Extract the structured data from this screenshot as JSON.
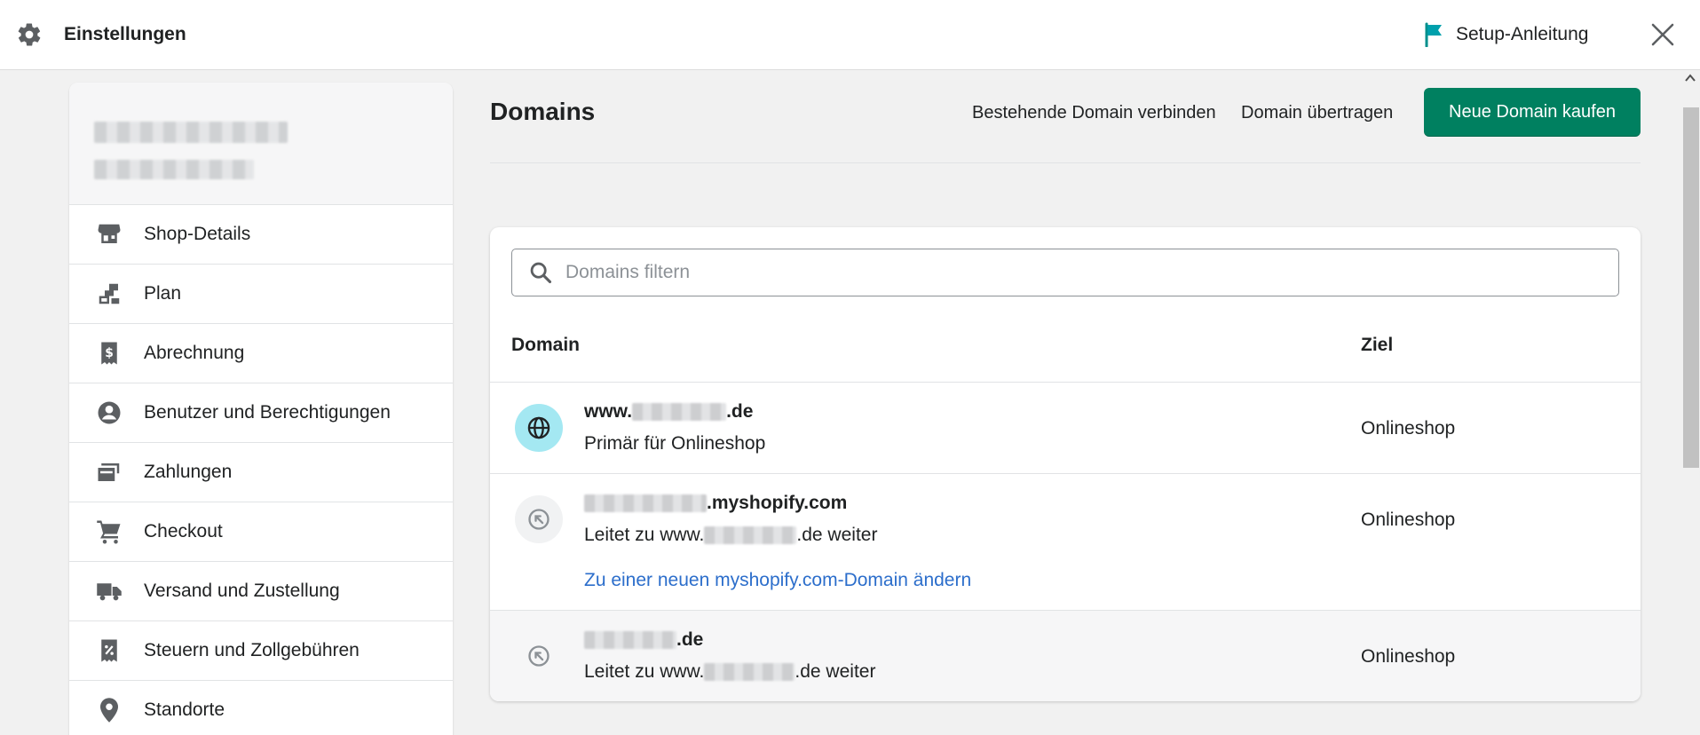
{
  "topbar": {
    "title": "Einstellungen",
    "setup_label": "Setup-Anleitung",
    "accent_color": "#008060",
    "icons": {
      "settings": "gear-icon",
      "setup": "flag-icon",
      "close": "close-icon"
    }
  },
  "sidebar": {
    "items": [
      {
        "label": "Shop-Details",
        "icon": "store-icon"
      },
      {
        "label": "Plan",
        "icon": "plan-icon"
      },
      {
        "label": "Abrechnung",
        "icon": "billing-icon"
      },
      {
        "label": "Benutzer und Berechtigungen",
        "icon": "user-icon"
      },
      {
        "label": "Zahlungen",
        "icon": "payments-icon"
      },
      {
        "label": "Checkout",
        "icon": "cart-icon"
      },
      {
        "label": "Versand und Zustellung",
        "icon": "truck-icon"
      },
      {
        "label": "Steuern und Zollgebühren",
        "icon": "tax-icon"
      },
      {
        "label": "Standorte",
        "icon": "location-icon"
      }
    ]
  },
  "main": {
    "title": "Domains",
    "connect_label": "Bestehende Domain verbinden",
    "transfer_label": "Domain übertragen",
    "buy_label": "Neue Domain kaufen",
    "buy_color": "#008060"
  },
  "table": {
    "search_placeholder": "Domains filtern",
    "columns": {
      "domain": "Domain",
      "target": "Ziel"
    },
    "rows": [
      {
        "name_prefix": "www.",
        "name_suffix": ".de",
        "subtitle": "Primär für Onlineshop",
        "target": "Onlineshop",
        "icon": "globe-icon"
      },
      {
        "name_prefix": "",
        "name_suffix": ".myshopify.com",
        "subtitle_prefix": "Leitet zu www.",
        "subtitle_suffix": ".de weiter",
        "target": "Onlineshop",
        "link": "Zu einer neuen myshopify.com-Domain ändern",
        "icon": "redirect-icon"
      },
      {
        "name_prefix": "",
        "name_suffix": ".de",
        "subtitle_prefix": "Leitet zu www.",
        "subtitle_suffix": ".de weiter",
        "target": "Onlineshop",
        "icon": "redirect-icon"
      }
    ],
    "link_color": "#2c6ecb"
  }
}
